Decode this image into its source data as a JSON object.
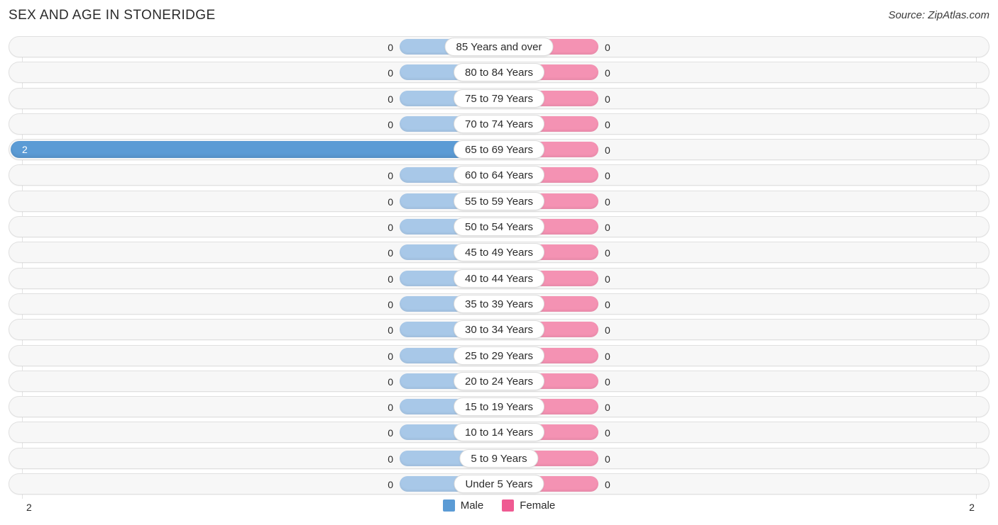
{
  "header": {
    "title": "SEX AND AGE IN STONERIDGE",
    "source": "Source: ZipAtlas.com"
  },
  "legend": {
    "male_label": "Male",
    "female_label": "Female",
    "male_color": "#5b9bd5",
    "female_color": "#ef5a92"
  },
  "axis": {
    "left_value": "2",
    "right_value": "2"
  },
  "chart_data": {
    "type": "bar",
    "title": "SEX AND AGE IN STONERIDGE",
    "subtitle": "Source: ZipAtlas.com",
    "orientation": "horizontal-diverging",
    "xlabel": "",
    "ylabel": "",
    "xlim": [
      2,
      2
    ],
    "grid": true,
    "legend_position": "bottom-center",
    "categories": [
      "85 Years and over",
      "80 to 84 Years",
      "75 to 79 Years",
      "70 to 74 Years",
      "65 to 69 Years",
      "60 to 64 Years",
      "55 to 59 Years",
      "50 to 54 Years",
      "45 to 49 Years",
      "40 to 44 Years",
      "35 to 39 Years",
      "30 to 34 Years",
      "25 to 29 Years",
      "20 to 24 Years",
      "15 to 19 Years",
      "10 to 14 Years",
      "5 to 9 Years",
      "Under 5 Years"
    ],
    "series": [
      {
        "name": "Male",
        "color": "#5b9bd5",
        "values": [
          0,
          0,
          0,
          0,
          2,
          0,
          0,
          0,
          0,
          0,
          0,
          0,
          0,
          0,
          0,
          0,
          0,
          0
        ]
      },
      {
        "name": "Female",
        "color": "#ef5a92",
        "values": [
          0,
          0,
          0,
          0,
          0,
          0,
          0,
          0,
          0,
          0,
          0,
          0,
          0,
          0,
          0,
          0,
          0,
          0
        ]
      }
    ]
  },
  "rows": [
    {
      "label": "85 Years and over",
      "male": "0",
      "female": "0",
      "male_filled": false
    },
    {
      "label": "80 to 84 Years",
      "male": "0",
      "female": "0",
      "male_filled": false
    },
    {
      "label": "75 to 79 Years",
      "male": "0",
      "female": "0",
      "male_filled": false
    },
    {
      "label": "70 to 74 Years",
      "male": "0",
      "female": "0",
      "male_filled": false
    },
    {
      "label": "65 to 69 Years",
      "male": "2",
      "female": "0",
      "male_filled": true
    },
    {
      "label": "60 to 64 Years",
      "male": "0",
      "female": "0",
      "male_filled": false
    },
    {
      "label": "55 to 59 Years",
      "male": "0",
      "female": "0",
      "male_filled": false
    },
    {
      "label": "50 to 54 Years",
      "male": "0",
      "female": "0",
      "male_filled": false
    },
    {
      "label": "45 to 49 Years",
      "male": "0",
      "female": "0",
      "male_filled": false
    },
    {
      "label": "40 to 44 Years",
      "male": "0",
      "female": "0",
      "male_filled": false
    },
    {
      "label": "35 to 39 Years",
      "male": "0",
      "female": "0",
      "male_filled": false
    },
    {
      "label": "30 to 34 Years",
      "male": "0",
      "female": "0",
      "male_filled": false
    },
    {
      "label": "25 to 29 Years",
      "male": "0",
      "female": "0",
      "male_filled": false
    },
    {
      "label": "20 to 24 Years",
      "male": "0",
      "female": "0",
      "male_filled": false
    },
    {
      "label": "15 to 19 Years",
      "male": "0",
      "female": "0",
      "male_filled": false
    },
    {
      "label": "10 to 14 Years",
      "male": "0",
      "female": "0",
      "male_filled": false
    },
    {
      "label": "5 to 9 Years",
      "male": "0",
      "female": "0",
      "male_filled": false
    },
    {
      "label": "Under 5 Years",
      "male": "0",
      "female": "0",
      "male_filled": false
    }
  ]
}
